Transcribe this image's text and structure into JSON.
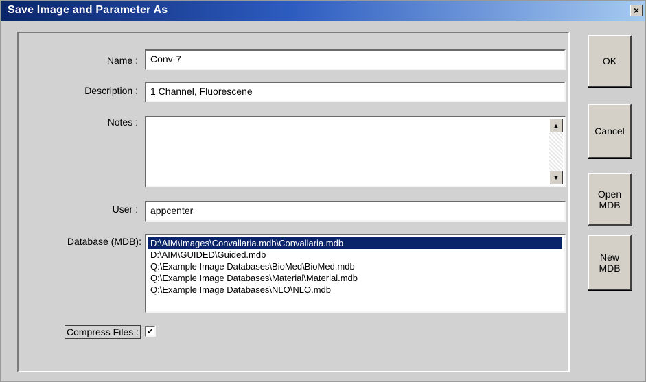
{
  "window": {
    "title": "Save Image and Parameter As",
    "close_glyph": "×"
  },
  "form": {
    "name_label": "Name :",
    "name_value": "Conv-7",
    "description_label": "Description :",
    "description_value": "1 Channel, Fluorescene",
    "notes_label": "Notes :",
    "notes_value": "",
    "user_label": "User :",
    "user_value": "appcenter",
    "database_label": "Database (MDB):",
    "database_items": [
      "D:\\AIM\\Images\\Convallaria.mdb\\Convallaria.mdb",
      "D:\\AIM\\GUIDED\\Guided.mdb",
      "Q:\\Example Image Databases\\BioMed\\BioMed.mdb",
      "Q:\\Example Image Databases\\Material\\Material.mdb",
      "Q:\\Example Image Databases\\NLO\\NLO.mdb"
    ],
    "database_selected_index": 0,
    "compress_label": "Compress Files :",
    "compress_checked": true,
    "check_glyph": "✓"
  },
  "buttons": {
    "ok": "OK",
    "cancel": "Cancel",
    "open_mdb_line1": "Open",
    "open_mdb_line2": "MDB",
    "new_mdb_line1": "New",
    "new_mdb_line2": "MDB"
  },
  "icons": {
    "scroll_up": "▲",
    "scroll_down": "▼"
  }
}
